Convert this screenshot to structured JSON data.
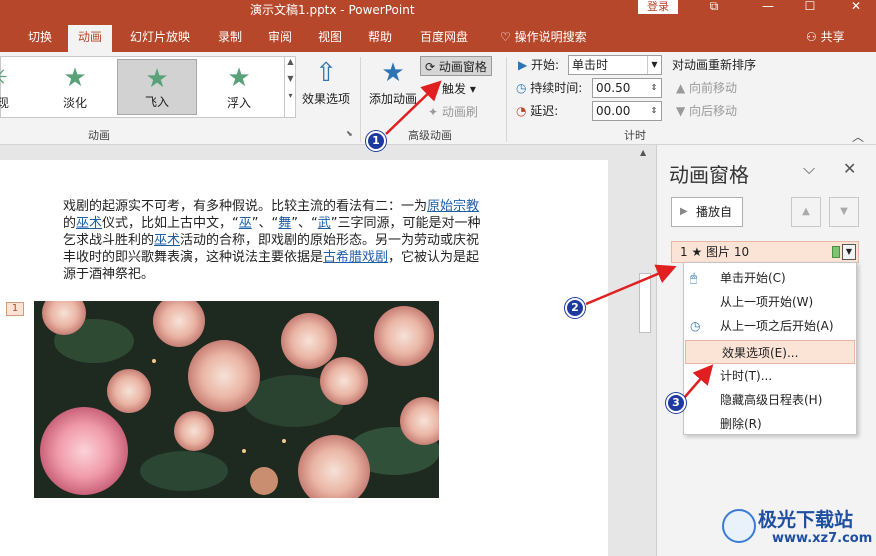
{
  "window": {
    "title": "演示文稿1.pptx  -  PowerPoint",
    "login_label": "登录"
  },
  "tabs": [
    "切换",
    "动画",
    "幻灯片放映",
    "录制",
    "审阅",
    "视图",
    "帮助",
    "百度网盘"
  ],
  "active_tab": "动画",
  "tell_me": "操作说明搜索",
  "share": "共享",
  "ribbon": {
    "gallery": [
      "现",
      "淡化",
      "飞入",
      "浮入"
    ],
    "effect_options": "效果选项",
    "group_animation": "动画",
    "add_animation": "添加动画",
    "animation_pane": "动画窗格",
    "trigger": "触发",
    "anim_painter": "动画刷",
    "group_advanced": "高级动画",
    "start_label": "开始:",
    "start_value": "单击时",
    "duration_label": "持续时间:",
    "duration_value": "00.50",
    "delay_label": "延迟:",
    "delay_value": "00.00",
    "group_timing": "计时",
    "reorder_title": "对动画重新排序",
    "move_earlier": "向前移动",
    "move_later": "向后移动"
  },
  "slide": {
    "paragraph_parts": [
      "戏剧的起源实不可考，有多种假说。比较主流的看法有二：一为",
      "原始宗教",
      "的",
      "巫术",
      "仪式，比如上古中文，“",
      "巫",
      "”、“",
      "舞",
      "”、“",
      "武",
      "”三字同源，可能是对一种乞求战斗胜利的",
      "巫术",
      "活动的合称，即戏剧的原始形态。另一为劳动或庆祝丰收时的即兴歌舞表演，这种说法主要依据是",
      "古希腊戏剧",
      "，它被认为是起源于酒神祭祀。"
    ],
    "animation_tag": "1"
  },
  "pane": {
    "title": "动画窗格",
    "play_label": "播放自",
    "item_label": "1 ★  图片 10"
  },
  "context_menu": [
    "单击开始(C)",
    "从上一项开始(W)",
    "从上一项之后开始(A)",
    "效果选项(E)...",
    "计时(T)...",
    "隐藏高级日程表(H)",
    "删除(R)"
  ],
  "context_menu_highlighted": "效果选项(E)...",
  "annotations": [
    "1",
    "2",
    "3"
  ],
  "watermark": {
    "text": "极光下载站",
    "url": "www.xz7.com"
  },
  "colors": {
    "accent": "#b7472a",
    "badge": "#1e3a9e",
    "arrow": "#e02020",
    "menu_highlight": "#fbe4d6"
  }
}
